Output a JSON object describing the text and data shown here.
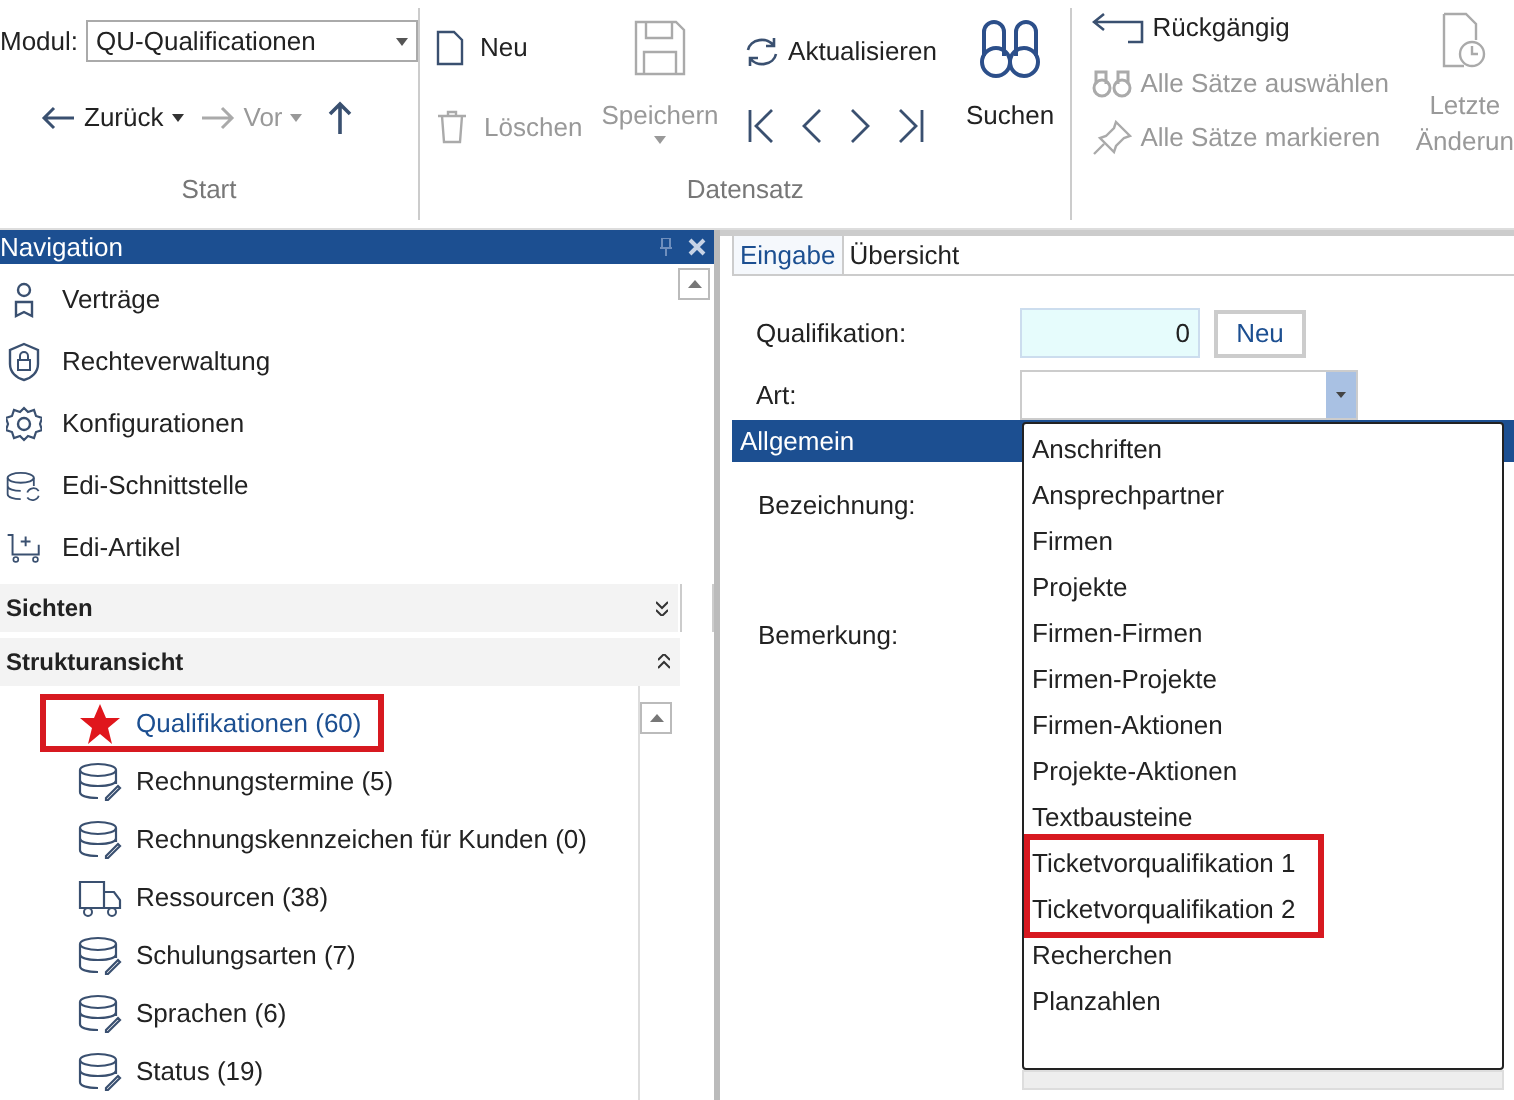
{
  "ribbon": {
    "modul_label": "Modul:",
    "modul_value": "QU-Qualificationen",
    "nav": [
      {
        "kind": "back",
        "label": "Zurück",
        "disabled": false
      },
      {
        "kind": "forward",
        "label": "Vor",
        "disabled": true
      },
      {
        "kind": "up",
        "disabled": false
      }
    ],
    "groups": [
      {
        "label": "Start"
      },
      {
        "label": "Datensatz"
      }
    ],
    "record": {
      "new": {
        "label": "Neu",
        "disabled": false
      },
      "delete": {
        "label": "Löschen",
        "disabled": true
      },
      "save": {
        "label": "Speichern",
        "disabled": true
      },
      "refresh": {
        "label": "Aktualisieren",
        "disabled": false
      },
      "search": {
        "label": "Suchen",
        "disabled": false
      }
    },
    "edit": [
      {
        "kind": "undo",
        "label": "Rückgängig",
        "disabled": false
      },
      {
        "kind": "select",
        "label": "Alle Sätze auswählen",
        "disabled": true
      },
      {
        "kind": "pin",
        "label": "Alle Sätze markieren",
        "disabled": true
      }
    ],
    "last_change": {
      "lines": [
        "Letzte",
        "Änderun"
      ],
      "disabled": true
    }
  },
  "navigation": {
    "title": "Navigation",
    "items": [
      {
        "kind": "contract",
        "label": "Verträge"
      },
      {
        "kind": "shield",
        "label": "Rechteverwaltung"
      },
      {
        "kind": "gear",
        "label": "Konfigurationen"
      },
      {
        "kind": "sync",
        "label": "Edi-Schnittstelle"
      },
      {
        "kind": "cart",
        "label": "Edi-Artikel"
      }
    ],
    "sections": [
      {
        "label": "Sichten",
        "expanded": false
      },
      {
        "label": "Strukturansicht",
        "expanded": true
      }
    ],
    "tree": [
      {
        "kind": "star",
        "label": "Qualifikationen (60)",
        "selected": true,
        "highlighted": true
      },
      {
        "kind": "db",
        "label": "Rechnungstermine (5)",
        "selected": false,
        "highlighted": false
      },
      {
        "kind": "db",
        "label": "Rechnungskennzeichen für Kunden (0)",
        "selected": false,
        "highlighted": false
      },
      {
        "kind": "truck",
        "label": "Ressourcen (38)",
        "selected": false,
        "highlighted": false
      },
      {
        "kind": "db",
        "label": "Schulungsarten (7)",
        "selected": false,
        "highlighted": false
      },
      {
        "kind": "db",
        "label": "Sprachen (6)",
        "selected": false,
        "highlighted": false
      },
      {
        "kind": "db",
        "label": "Status (19)",
        "selected": false,
        "highlighted": false
      }
    ]
  },
  "editor": {
    "tabs": [
      {
        "label": "Eingabe",
        "selected": true
      },
      {
        "label": "Übersicht",
        "selected": false
      }
    ],
    "qualifikation_label": "Qualifikation:",
    "qualifikation_value": "0",
    "new_button": "Neu",
    "art_label": "Art:",
    "section": "Allgemein",
    "bezeichnung_label": "Bezeichnung:",
    "bemerkung_label": "Bemerkung:",
    "dropdown": [
      {
        "label": "Anschriften",
        "highlighted": false
      },
      {
        "label": "Ansprechpartner",
        "highlighted": false
      },
      {
        "label": "Firmen",
        "highlighted": false
      },
      {
        "label": "Projekte",
        "highlighted": false
      },
      {
        "label": "Firmen-Firmen",
        "highlighted": false
      },
      {
        "label": "Firmen-Projekte",
        "highlighted": false
      },
      {
        "label": "Firmen-Aktionen",
        "highlighted": false
      },
      {
        "label": "Projekte-Aktionen",
        "highlighted": false
      },
      {
        "label": "Textbausteine",
        "highlighted": false
      },
      {
        "label": "Ticketvorqualifikation 1",
        "highlighted": true
      },
      {
        "label": "Ticketvorqualifikation 2",
        "highlighted": true
      },
      {
        "label": "Recherchen",
        "highlighted": false
      },
      {
        "label": "Planzahlen",
        "highlighted": false
      }
    ]
  }
}
